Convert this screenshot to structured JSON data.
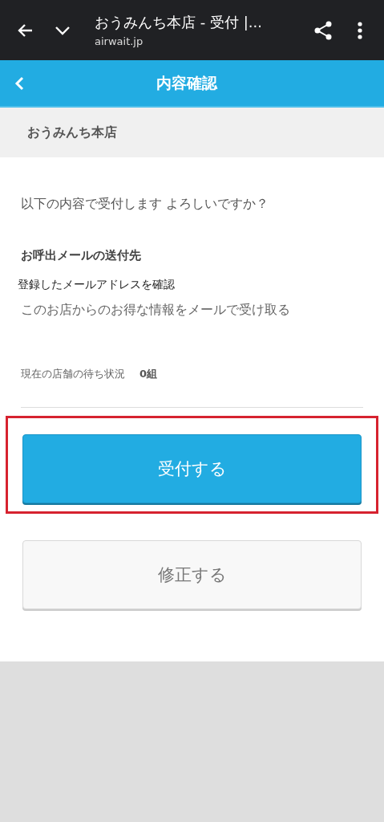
{
  "browser_bar": {
    "title": "おうみんち本店 - 受付 |...",
    "url": "airwait.jp"
  },
  "header": {
    "title": "内容確認"
  },
  "shop": {
    "name": "おうみんち本店"
  },
  "confirm_message": "以下の内容で受付します よろしいですか？",
  "mail_section": {
    "heading": "お呼出メールの送付先",
    "link": "登録したメールアドレスを確認",
    "opt_in": "このお店からのお得な情報をメールで受け取る"
  },
  "wait_status": {
    "label": "現在の店舗の待ち状況",
    "value": "0組"
  },
  "buttons": [
    {
      "label": "受付する",
      "kind": "primary",
      "highlighted": true
    },
    {
      "label": "修正する",
      "kind": "secondary",
      "highlighted": false
    }
  ]
}
